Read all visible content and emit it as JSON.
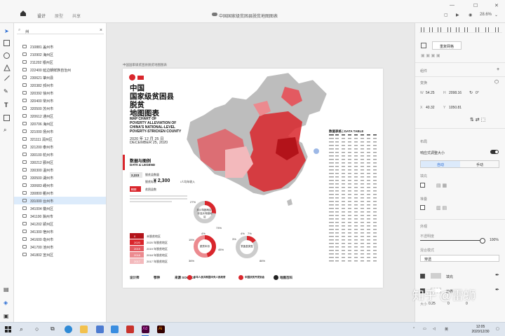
{
  "titlebar": {
    "tabs": [
      "设计",
      "原型",
      "共享"
    ],
    "active_tab": "设计",
    "doc_title": "中国国家级贫困县脱贫地图图表",
    "zoom": "28.6%",
    "window_controls": [
      "—",
      "☐",
      "✕"
    ]
  },
  "layers": {
    "search_value": "州",
    "items": [
      "210881 盖州市",
      "210902 海州区",
      "211202 银州区",
      "222400 延边朝鲜族自治州",
      "230621 肇州县",
      "320382 邳州市",
      "320392 徐州市",
      "320400 常州市",
      "320500 苏州市",
      "320612 通州区",
      "320706 海州区",
      "321000 扬州市",
      "321111 润州区",
      "321200 泰州市",
      "330100 杭州市",
      "330212 鄞州区",
      "330300 温州市",
      "330500 湖州市",
      "330683 嵊州市",
      "330800 衢州市",
      "331000 台州市",
      "341004 徽州区",
      "341100 滁州市",
      "341202 颍州区",
      "341300 宿州市",
      "341600 亳州市",
      "341700 池州市",
      "341802 宣州区"
    ],
    "selected": "331000 台州市"
  },
  "canvas": {
    "artboard_label": "中国国家级贫困县脱贫地图图表",
    "poster": {
      "title_lines": [
        "中国",
        "国家级贫困县",
        "脱贫",
        "地图图表"
      ],
      "en_lines": [
        "MAP CHART OF",
        "POVERTY ALLEVIATION OF",
        "CHINA'S NATIONAL-LEVEL",
        "POVERTY-STRICKEN COUNTY"
      ],
      "date_zh": "2020 年 12 月 25 日",
      "date_en": "DECEMBER 25, 2020",
      "legend_title": "数据与图例",
      "legend_subtitle": "DATA & LEGEND",
      "stat_count": "2,223",
      "stat_count_label": "脱贫县数量",
      "stat_label2": "脱贫标准",
      "money": "¥ 2,300",
      "money_unit": "/人均年收入",
      "stat_count2": "832",
      "stat_count2_label": "贫困县数",
      "legend_rows": [
        {
          "code": "0",
          "label": "未脱贫地区",
          "color": "#b3131a"
        },
        {
          "code": "2020",
          "label": "2020 年脱贫地区",
          "color": "#d9262c"
        },
        {
          "code": "2019",
          "label": "2019 年脱贫地区",
          "color": "#e35a61"
        },
        {
          "code": "2018",
          "label": "2018 年脱贫地区",
          "color": "#ec8a8f"
        },
        {
          "code": "2017",
          "label": "2017 年脱贫地区",
          "color": "#f3b9bc"
        }
      ],
      "data_table_title": "数据表格 | DATA TABLE",
      "donut1": {
        "pct_a": "27%",
        "pct_b": "73%",
        "center": "连片特困地区 / 非连片特困地区"
      },
      "donut2": {
        "pct_a": "4%",
        "pct_b": "15%",
        "pct_c": "36%",
        "pct_d": "45%",
        "center": "脱贫年份"
      },
      "donut3": {
        "pct_a": "4%",
        "pct_b": "7%",
        "pct_c": "3%",
        "pct_d": "86%",
        "center": "贫困县类型"
      },
      "logos": [
        "设计师",
        "鄂伸",
        "来源 SOURCE",
        "中华人民共和国中央人民政府",
        "中国扶贫开发协会",
        "地图百科"
      ]
    }
  },
  "rpanel": {
    "repeat_grid": "重复网格",
    "section_component": "组件",
    "section_transform": "变换",
    "w": "54.25",
    "h": "2098.16",
    "rot": "0°",
    "x": "40.32",
    "y": "1050.81",
    "section_layout": "布局",
    "responsive": "响应式调整大小",
    "seg_auto": "自动",
    "seg_manual": "手动",
    "padding": "填充",
    "layout_type": "堆叠",
    "section_appearance": "外观",
    "opacity": "不透明度",
    "opacity_value": "100%",
    "blend": "混合模式",
    "blend_value": "穿透",
    "fill": "填充",
    "border": "边界",
    "border_size": "0.25",
    "dash": "0",
    "gap": "0"
  },
  "watermark": "知乎 @雷蛳",
  "taskbar": {
    "time": "12:05",
    "date": "2020/12/30",
    "ime": "英"
  },
  "colors": {
    "accent": "#d9262c",
    "selection": "#dcebfb",
    "blue": "#2b6cd3"
  }
}
